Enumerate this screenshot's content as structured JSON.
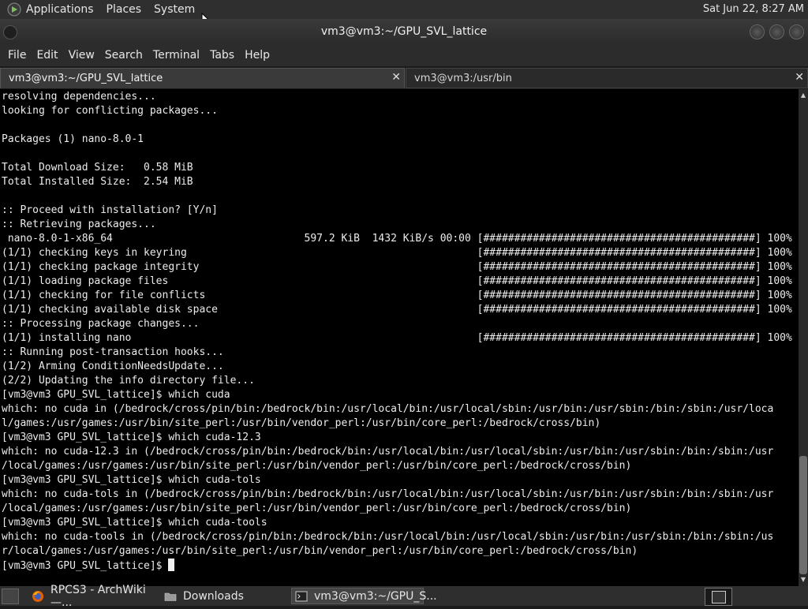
{
  "top_panel": {
    "menus": [
      "Applications",
      "Places",
      "System"
    ],
    "clock": "Sat Jun 22,  8:27 AM"
  },
  "window": {
    "title": "vm3@vm3:~/GPU_SVL_lattice"
  },
  "menubar": [
    "File",
    "Edit",
    "View",
    "Search",
    "Terminal",
    "Tabs",
    "Help"
  ],
  "tabs": [
    {
      "label": "vm3@vm3:~/GPU_SVL_lattice",
      "close": "✕"
    },
    {
      "label": "vm3@vm3:/usr/bin",
      "close": "✕"
    }
  ],
  "terminal": {
    "lines": [
      "resolving dependencies...",
      "looking for conflicting packages...",
      "",
      "Packages (1) nano-8.0-1",
      "",
      "Total Download Size:   0.58 MiB",
      "Total Installed Size:  2.54 MiB",
      "",
      ":: Proceed with installation? [Y/n]",
      ":: Retrieving packages...",
      " nano-8.0-1-x86_64                               597.2 KiB  1432 KiB/s 00:00 [############################################] 100%",
      "(1/1) checking keys in keyring                                               [############################################] 100%",
      "(1/1) checking package integrity                                             [############################################] 100%",
      "(1/1) loading package files                                                  [############################################] 100%",
      "(1/1) checking for file conflicts                                            [############################################] 100%",
      "(1/1) checking available disk space                                          [############################################] 100%",
      ":: Processing package changes...",
      "(1/1) installing nano                                                        [############################################] 100%",
      ":: Running post-transaction hooks...",
      "(1/2) Arming ConditionNeedsUpdate...",
      "(2/2) Updating the info directory file...",
      "[vm3@vm3 GPU_SVL_lattice]$ which cuda",
      "which: no cuda in (/bedrock/cross/pin/bin:/bedrock/bin:/usr/local/bin:/usr/local/sbin:/usr/bin:/usr/sbin:/bin:/sbin:/usr/loca",
      "l/games:/usr/games:/usr/bin/site_perl:/usr/bin/vendor_perl:/usr/bin/core_perl:/bedrock/cross/bin)",
      "[vm3@vm3 GPU_SVL_lattice]$ which cuda-12.3",
      "which: no cuda-12.3 in (/bedrock/cross/pin/bin:/bedrock/bin:/usr/local/bin:/usr/local/sbin:/usr/bin:/usr/sbin:/bin:/sbin:/usr",
      "/local/games:/usr/games:/usr/bin/site_perl:/usr/bin/vendor_perl:/usr/bin/core_perl:/bedrock/cross/bin)",
      "[vm3@vm3 GPU_SVL_lattice]$ which cuda-tols",
      "which: no cuda-tols in (/bedrock/cross/pin/bin:/bedrock/bin:/usr/local/bin:/usr/local/sbin:/usr/bin:/usr/sbin:/bin:/sbin:/usr",
      "/local/games:/usr/games:/usr/bin/site_perl:/usr/bin/vendor_perl:/usr/bin/core_perl:/bedrock/cross/bin)",
      "[vm3@vm3 GPU_SVL_lattice]$ which cuda-tools",
      "which: no cuda-tools in (/bedrock/cross/pin/bin:/bedrock/bin:/usr/local/bin:/usr/local/sbin:/usr/bin:/usr/sbin:/bin:/sbin:/us",
      "r/local/games:/usr/games:/usr/bin/site_perl:/usr/bin/vendor_perl:/usr/bin/core_perl:/bedrock/cross/bin)",
      "[vm3@vm3 GPU_SVL_lattice]$"
    ]
  },
  "taskbar": {
    "items": [
      {
        "label": "RPCS3 - ArchWiki —...",
        "icon": "firefox-icon"
      },
      {
        "label": "Downloads",
        "icon": "folder-icon"
      },
      {
        "label": "vm3@vm3:~/GPU_S...",
        "icon": "terminal-icon"
      }
    ]
  }
}
